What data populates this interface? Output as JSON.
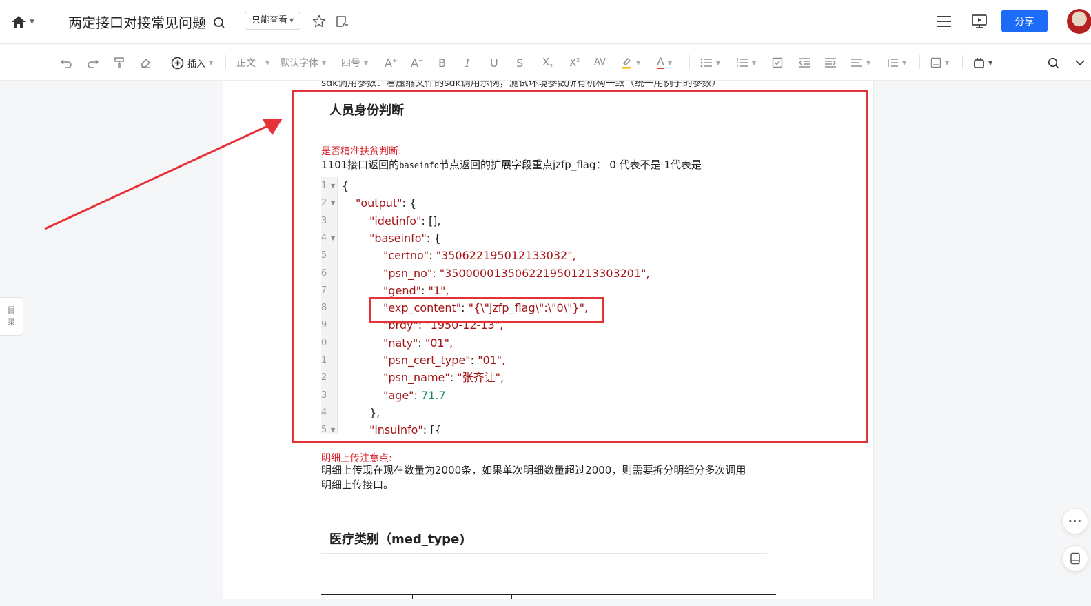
{
  "header": {
    "title": "两定接口对接常见问题",
    "permission": "只能查看",
    "share_label": "分享"
  },
  "toolbar": {
    "insert_label": "插入",
    "style_label": "正文",
    "font_label": "默认字体",
    "size_label": "四号"
  },
  "doc": {
    "cut_line": "sdk调用参数：看压缩文件的sdk调用示例，测试环境参数所有机构一致（统一用例子的参数）",
    "section1_title": "人员身份判断",
    "red_label1": "是否精准扶贫判断:",
    "para1_a": "1101接口返回的",
    "para1_code": "baseinfo",
    "para1_b": "节点返回的扩展字段重点jzfp_flag： 0 代表不是 1代表是",
    "red_label2": "明细上传注意点:",
    "para2_line1": "明细上传现在现在数量为2000条，如果单次明细数量超过2000，则需要拆分明细分多次调用",
    "para2_line2": "明细上传接口。",
    "section2_title": "医疗类别（med_type)"
  },
  "code_lines": [
    {
      "ln": "1",
      "fold": true,
      "k": "",
      "sep": "",
      "v": "{",
      "vt": "p"
    },
    {
      "ln": "2",
      "fold": true,
      "k": "\"output\"",
      "sep": ": ",
      "v": "{",
      "vt": "p"
    },
    {
      "ln": "3",
      "fold": false,
      "k": "\"idetinfo\"",
      "sep": ": ",
      "v": "[],",
      "vt": "p"
    },
    {
      "ln": "4",
      "fold": true,
      "k": "\"baseinfo\"",
      "sep": ": ",
      "v": "{",
      "vt": "p"
    },
    {
      "ln": "5",
      "fold": false,
      "k": "\"certno\"",
      "sep": ": ",
      "v": "\"350622195012133032\",",
      "vt": "s"
    },
    {
      "ln": "6",
      "fold": false,
      "k": "\"psn_no\"",
      "sep": ": ",
      "v": "\"3500000135062219501213303201\",",
      "vt": "s"
    },
    {
      "ln": "7",
      "fold": false,
      "k": "\"gend\"",
      "sep": ": ",
      "v": "\"1\",",
      "vt": "s"
    },
    {
      "ln": "8",
      "fold": false,
      "k": "\"exp_content\"",
      "sep": ": ",
      "v": "\"{\\\"jzfp_flag\\\":\\\"0\\\"}\",",
      "vt": "s"
    },
    {
      "ln": "9",
      "fold": false,
      "k": "\"brdy\"",
      "sep": ": ",
      "v": "\"1950-12-13\",",
      "vt": "s"
    },
    {
      "ln": "0",
      "fold": false,
      "k": "\"naty\"",
      "sep": ": ",
      "v": "\"01\",",
      "vt": "s"
    },
    {
      "ln": "1",
      "fold": false,
      "k": "\"psn_cert_type\"",
      "sep": ": ",
      "v": "\"01\",",
      "vt": "s"
    },
    {
      "ln": "2",
      "fold": false,
      "k": "\"psn_name\"",
      "sep": ": ",
      "v": "\"张齐让\",",
      "vt": "s"
    },
    {
      "ln": "3",
      "fold": false,
      "k": "\"age\"",
      "sep": ": ",
      "v": "71.7",
      "vt": "n"
    },
    {
      "ln": "4",
      "fold": false,
      "k": "",
      "sep": "",
      "v": "},",
      "vt": "p"
    },
    {
      "ln": "5",
      "fold": true,
      "k": "\"insuinfo\"",
      "sep": ": ",
      "v": "[{",
      "vt": "p"
    }
  ],
  "sidebar": {
    "toc_char1": "目",
    "toc_char2": "录"
  },
  "colors": {
    "accent": "#1d6cf7",
    "annotation_red": "#e53238",
    "json_key": "#a31515",
    "json_number": "#0b8a5a"
  },
  "icons": [
    "home-icon",
    "search-icon",
    "star-icon",
    "comment-icon",
    "menu-icon",
    "present-icon",
    "undo-icon",
    "redo-icon",
    "format-painter-icon",
    "eraser-icon",
    "plus-circle-icon"
  ]
}
